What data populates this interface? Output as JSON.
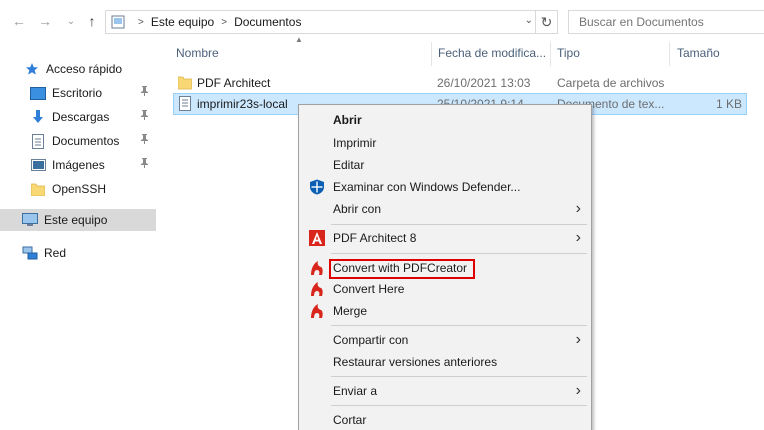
{
  "nav": {
    "back": "←",
    "forward": "→",
    "recent": "⌄",
    "up": "↑"
  },
  "address": {
    "crumbs": [
      "Este equipo",
      "Documentos"
    ],
    "dropdown": "⌄",
    "refresh": "↻"
  },
  "search": {
    "placeholder": "Buscar en Documentos"
  },
  "sidebar": {
    "items": [
      {
        "label": "Acceso rápido",
        "icon": "star-icon"
      },
      {
        "label": "Escritorio",
        "icon": "desktop-icon"
      },
      {
        "label": "Descargas",
        "icon": "downloads-icon"
      },
      {
        "label": "Documentos",
        "icon": "documents-icon"
      },
      {
        "label": "Imágenes",
        "icon": "pictures-icon"
      },
      {
        "label": "OpenSSH",
        "icon": "folder-icon"
      },
      {
        "label": "Este equipo",
        "icon": "computer-icon"
      },
      {
        "label": "Red",
        "icon": "network-icon"
      }
    ],
    "pin": "📌"
  },
  "columns": {
    "name": "Nombre",
    "date": "Fecha de modifica...",
    "type": "Tipo",
    "size": "Tamaño"
  },
  "files": [
    {
      "name": "PDF Architect",
      "date": "26/10/2021 13:03",
      "type": "Carpeta de archivos",
      "size": ""
    },
    {
      "name": "imprimir23s-local",
      "date": "25/10/2021 9:14",
      "type": "Documento de tex...",
      "size": "1 KB"
    }
  ],
  "menu": {
    "items": [
      {
        "label": "Abrir"
      },
      {
        "label": "Imprimir"
      },
      {
        "label": "Editar"
      },
      {
        "label": "Examinar con Windows Defender..."
      },
      {
        "label": "Abrir con"
      },
      {
        "label": "PDF Architect 8"
      },
      {
        "label": "Convert with PDFCreator"
      },
      {
        "label": "Convert Here"
      },
      {
        "label": "Merge"
      },
      {
        "label": "Compartir con"
      },
      {
        "label": "Restaurar versiones anteriores"
      },
      {
        "label": "Enviar a"
      },
      {
        "label": "Cortar"
      }
    ],
    "submenu_arrow": "›"
  },
  "colors": {
    "selection_bg": "#cce8ff",
    "selection_border": "#99d1ff",
    "highlight_box": "#e00000",
    "pdfcreator_red": "#d9261c",
    "defender_blue": "#0a5fb4"
  }
}
